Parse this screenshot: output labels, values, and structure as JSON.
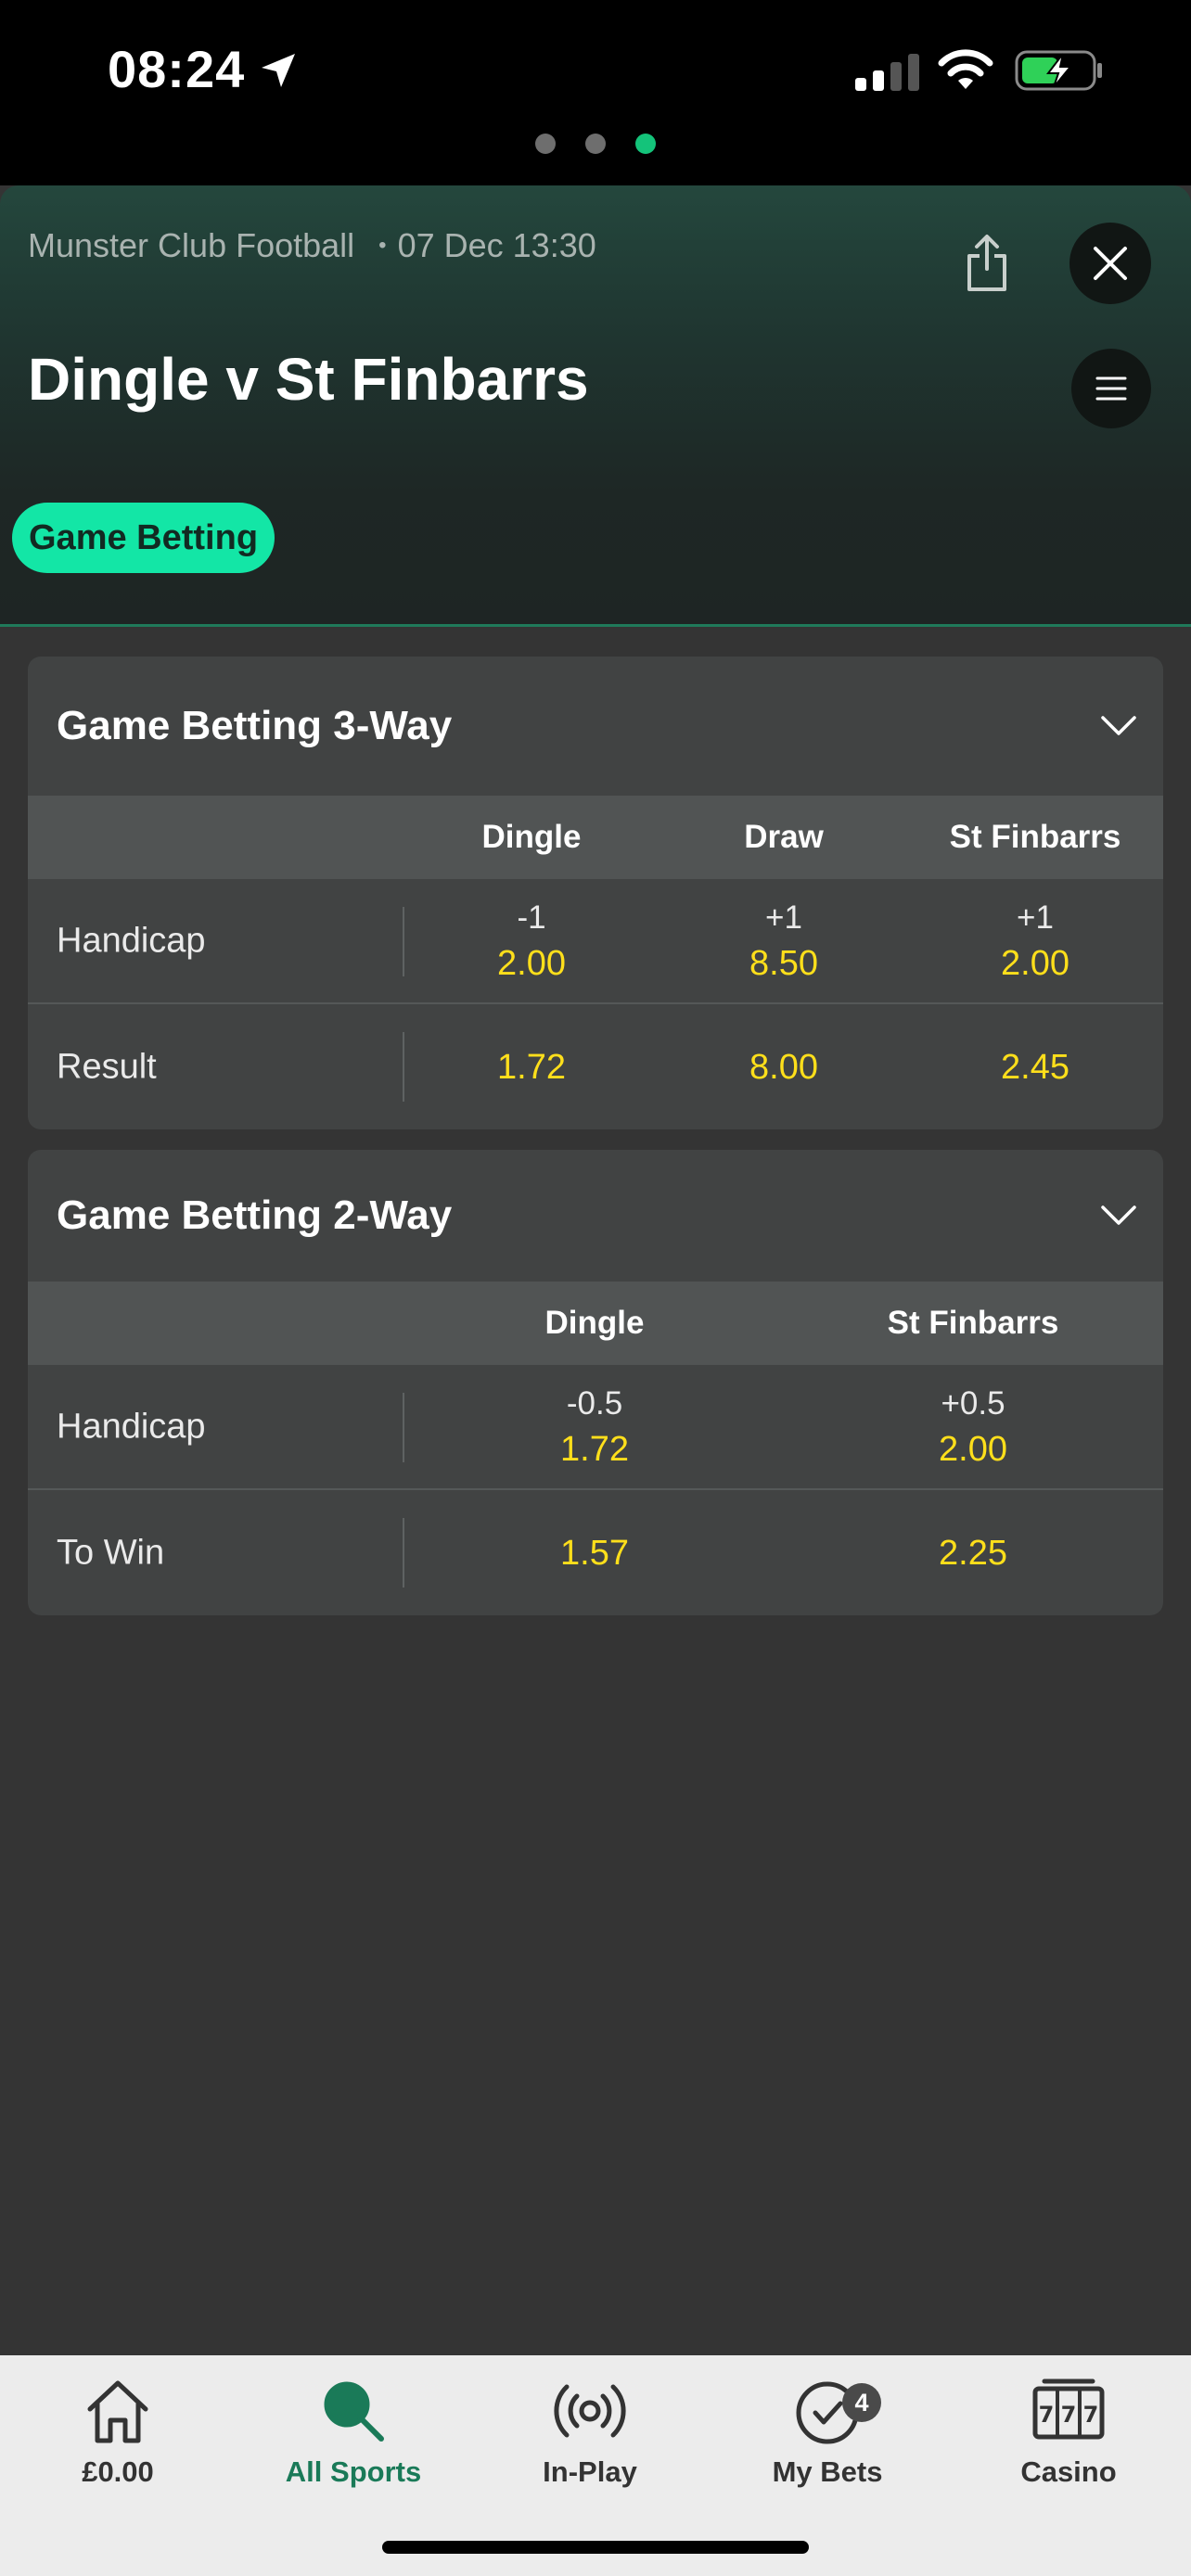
{
  "status_bar": {
    "time": "08:24",
    "icons": [
      "location-arrow-icon",
      "cellular-signal-icon",
      "wifi-icon",
      "battery-charging-icon"
    ],
    "page_dots": 3,
    "active_dot": 3,
    "colors": {
      "active_dot": "#14c37a"
    }
  },
  "header": {
    "competition": "Munster Club Football",
    "separator": "•",
    "datetime": "07 Dec 13:30",
    "title": "Dingle v St Finbarrs",
    "active_tab": "Game Betting",
    "icons": [
      "share-icon",
      "close-icon",
      "menu-icon"
    ]
  },
  "markets": [
    {
      "title": "Game Betting 3-Way",
      "columns": [
        "Dingle",
        "Draw",
        "St Finbarrs"
      ],
      "rows": [
        {
          "label": "Handicap",
          "cells": [
            {
              "hcp": "-1",
              "price": "2.00"
            },
            {
              "hcp": "+1",
              "price": "8.50"
            },
            {
              "hcp": "+1",
              "price": "2.00"
            }
          ]
        },
        {
          "label": "Result",
          "cells": [
            {
              "price": "1.72"
            },
            {
              "price": "8.00"
            },
            {
              "price": "2.45"
            }
          ]
        }
      ]
    },
    {
      "title": "Game Betting 2-Way",
      "columns": [
        "Dingle",
        "St Finbarrs"
      ],
      "rows": [
        {
          "label": "Handicap",
          "cells": [
            {
              "hcp": "-0.5",
              "price": "1.72"
            },
            {
              "hcp": "+0.5",
              "price": "2.00"
            }
          ]
        },
        {
          "label": "To Win",
          "cells": [
            {
              "price": "1.57"
            },
            {
              "price": "2.25"
            }
          ]
        }
      ]
    }
  ],
  "bottom_nav": {
    "items": [
      {
        "label": "£0.00",
        "icon": "home-icon"
      },
      {
        "label": "All Sports",
        "icon": "search-icon",
        "active": true
      },
      {
        "label": "In-Play",
        "icon": "broadcast-icon"
      },
      {
        "label": "My Bets",
        "icon": "check-circle-icon",
        "badge": "4"
      },
      {
        "label": "Casino",
        "icon": "slot-machine-icon"
      }
    ]
  },
  "colors": {
    "accent": "#13e6a6",
    "odds": "#ffdf1b",
    "active_nav": "#1a7a58"
  }
}
